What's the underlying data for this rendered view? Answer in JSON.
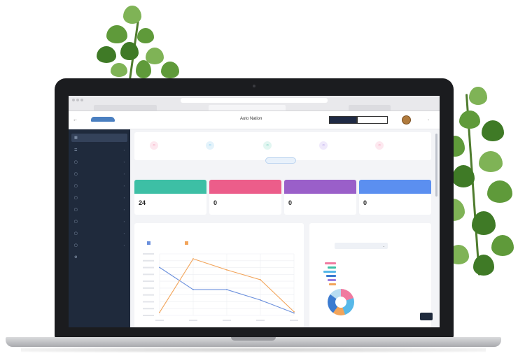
{
  "browser": {
    "address": "",
    "tabs": [
      "",
      "",
      ""
    ]
  },
  "header": {
    "title": "Auto Nation",
    "seg_active": "",
    "seg_inactive": "",
    "user_name": ""
  },
  "logo": {
    "text": ""
  },
  "sidebar": {
    "items": [
      {
        "label": "",
        "icon": "dashboard-icon"
      },
      {
        "label": "",
        "icon": "menu-icon"
      },
      {
        "label": "",
        "icon": "folder-icon"
      },
      {
        "label": "",
        "icon": "folder-icon"
      },
      {
        "label": "",
        "icon": "folder-icon"
      },
      {
        "label": "",
        "icon": "folder-icon"
      },
      {
        "label": "",
        "icon": "folder-icon"
      },
      {
        "label": "",
        "icon": "folder-icon"
      },
      {
        "label": "",
        "icon": "folder-icon"
      },
      {
        "label": "",
        "icon": "folder-icon"
      },
      {
        "label": "",
        "icon": "settings-icon"
      }
    ]
  },
  "quick_actions": [
    {
      "label": "",
      "color": "#f07aa0",
      "bg": "#fde8ef"
    },
    {
      "label": "",
      "color": "#57b8e8",
      "bg": "#e4f3fb"
    },
    {
      "label": "",
      "color": "#3dbfa5",
      "bg": "#e2f6f1"
    },
    {
      "label": "",
      "color": "#9a7be0",
      "bg": "#efe9fb"
    },
    {
      "label": "",
      "color": "#f07aa0",
      "bg": "#fde8ef"
    }
  ],
  "see_more": "",
  "stats": [
    {
      "label": "",
      "value": "24",
      "color": "#3dbfa5"
    },
    {
      "label": "",
      "value": "0",
      "color": "#ec5d8a"
    },
    {
      "label": "",
      "value": "0",
      "color": "#9a5fc9"
    },
    {
      "label": "",
      "value": "0",
      "color": "#5b8ff0"
    }
  ],
  "sales_report": {
    "title": "",
    "legend": [
      {
        "name": "",
        "color": "#6a8fdc"
      },
      {
        "name": "",
        "color": "#f2a45a"
      }
    ]
  },
  "chart_data": {
    "type": "line",
    "title": "",
    "categories": [
      "",
      "",
      "",
      "",
      ""
    ],
    "series": [
      {
        "name": "",
        "color": "#6a8fdc",
        "values": [
          0.78,
          0.42,
          0.42,
          0.25,
          0.04
        ]
      },
      {
        "name": "",
        "color": "#f2a45a",
        "values": [
          0.05,
          0.92,
          0.74,
          0.58,
          0.06
        ]
      }
    ],
    "ylim": [
      0,
      1
    ],
    "grid": true
  },
  "vehicle_card": {
    "title": "",
    "period_label": "",
    "period_value": "",
    "legend": [
      {
        "label": "",
        "color": "#f07aa0"
      },
      {
        "label": "",
        "color": "#3dbfa5"
      },
      {
        "label": "",
        "color": "#57b8e8"
      },
      {
        "label": "",
        "color": "#3b7bd0"
      },
      {
        "label": "",
        "color": "#9a7be0"
      },
      {
        "label": "",
        "color": "#f2a45a"
      }
    ],
    "summary": [
      {
        "label": "",
        "color": "#ec5d8a"
      },
      {
        "label": "",
        "color": "#3dbfa5"
      },
      {
        "label": "",
        "color": "#57b8e8"
      },
      {
        "label": "",
        "color": "#555555"
      },
      {
        "label": "",
        "color": "#f2a45a"
      }
    ],
    "go_label": ""
  },
  "laptop": {
    "brand": ""
  }
}
